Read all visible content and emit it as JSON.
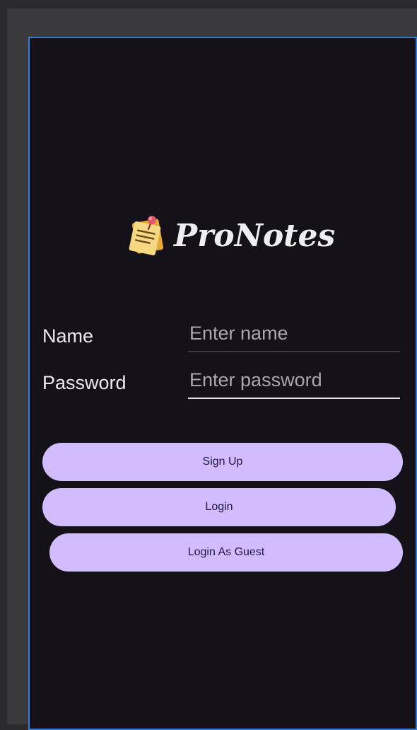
{
  "app": {
    "title": "ProNotes"
  },
  "form": {
    "name_label": "Name",
    "name_placeholder": "Enter name",
    "password_label": "Password",
    "password_placeholder": "Enter password"
  },
  "buttons": {
    "signup_label": "Sign Up",
    "login_label": "Login",
    "guest_label": "Login As Guest"
  },
  "colors": {
    "background": "#141218",
    "button": "#d0bcff",
    "frame_border": "#2f7fd8"
  },
  "icons": {
    "logo": "sticky-note-icon"
  }
}
